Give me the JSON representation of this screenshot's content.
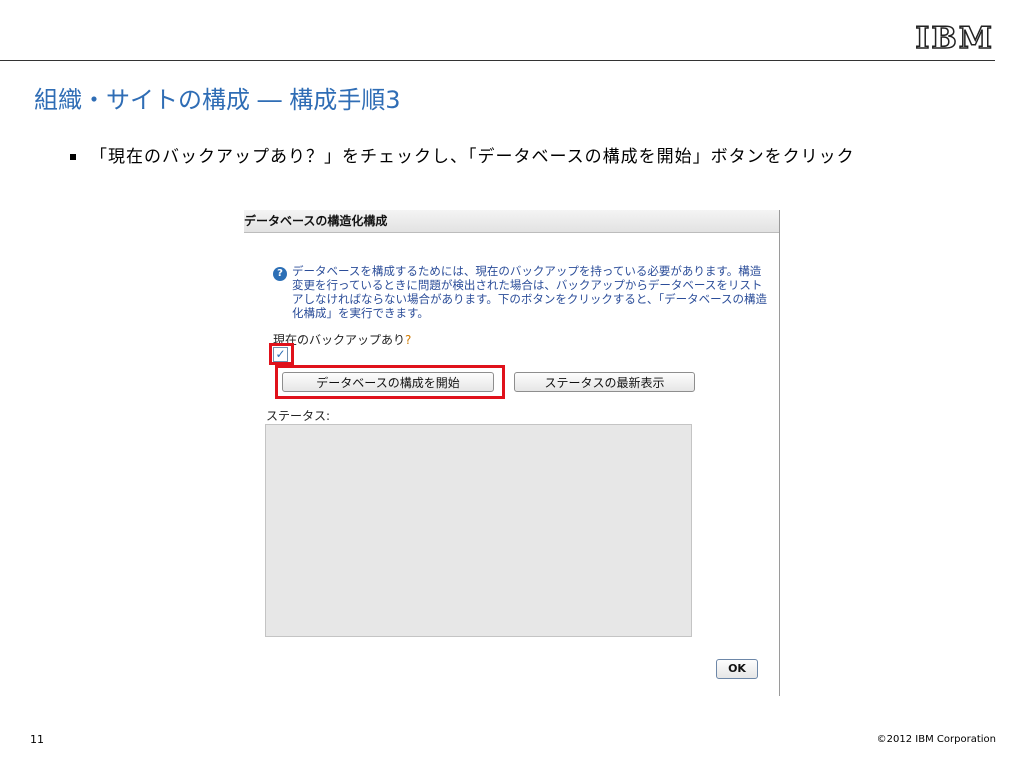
{
  "header": {
    "logo": "IBM"
  },
  "slide": {
    "title": "組織・サイトの構成 ― 構成手順3",
    "bullet": "「現在のバックアップあり？」をチェックし、「データベースの構成を開始」ボタンをクリック"
  },
  "dialog": {
    "title": "データベースの構造化構成",
    "info_text": "データベースを構成するためには、現在のバックアップを持っている必要があります。構造変更を行っているときに問題が検出された場合は、バックアップからデータベースをリストアしなければならない場合があります。下のボタンをクリックすると、「データベースの構造化構成」を実行できます。",
    "backup_label": "現在のバックアップあり",
    "backup_question_mark": "?",
    "backup_checked": true,
    "checkbox_mark": "✓",
    "start_button": "データベースの構成を開始",
    "refresh_button": "ステータスの最新表示",
    "status_label": "ステータス:",
    "status_value": "",
    "ok_button": "OK"
  },
  "colors": {
    "title": "#2f6db5",
    "highlight": "#e0111b",
    "info_text": "#2b4d99",
    "status_area": "#e7e7e7"
  },
  "icons": {
    "info": "info-icon",
    "info_glyph": "?"
  },
  "footer": {
    "page_number": "11",
    "copyright": "©2012 IBM Corporation"
  }
}
